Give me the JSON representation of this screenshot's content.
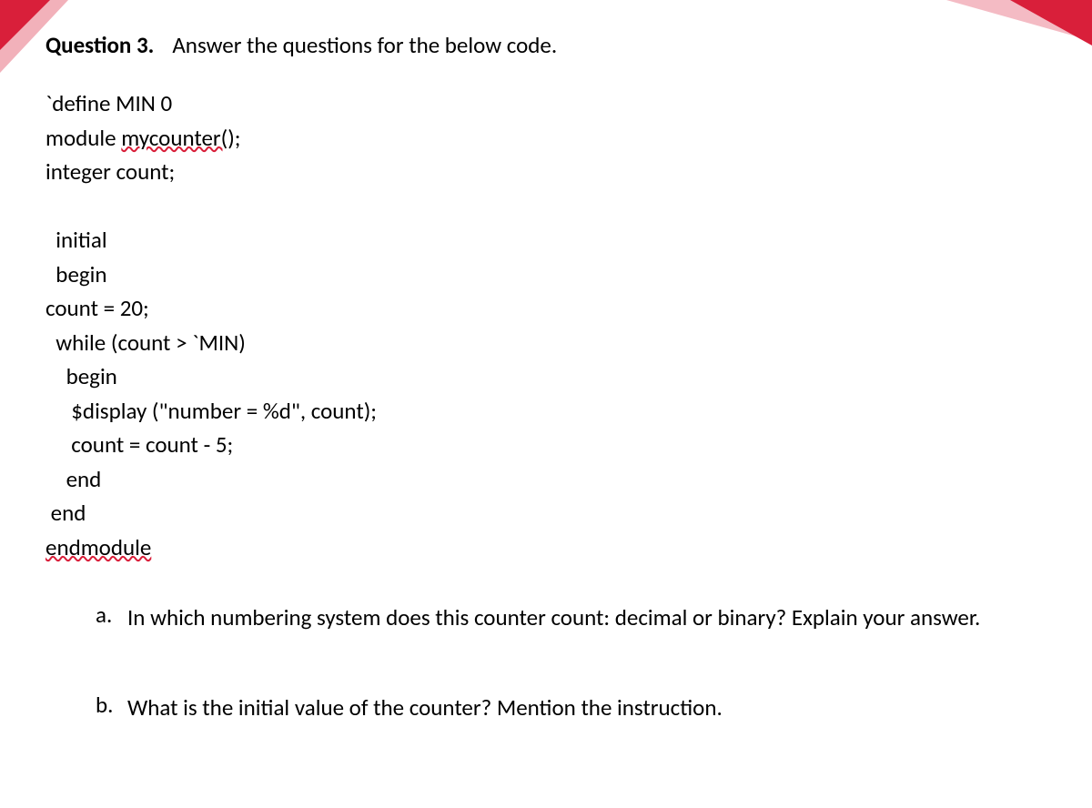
{
  "header": {
    "label": "Question 3.",
    "prompt": "Answer the questions for the below code."
  },
  "code": {
    "l1": "`define MIN 0",
    "l2a": "module ",
    "l2b": "mycounter(",
    "l2c": ");",
    "l3": "integer count;",
    "l4": "  initial",
    "l5": "  begin",
    "l6": "count = 20;",
    "l7": "  while (count > `MIN)",
    "l8": "    begin",
    "l9": "     $display (\"number = %d\", count);",
    "l10": "     count = count - 5;",
    "l11": "    end",
    "l12": " end",
    "l13": "endmodule"
  },
  "subs": {
    "a_marker": "a.",
    "a_text": "In which numbering system does this counter count: decimal or binary? Explain your answer.",
    "b_marker": "b.",
    "b_text": "What is the initial value of the counter? Mention the instruction."
  }
}
